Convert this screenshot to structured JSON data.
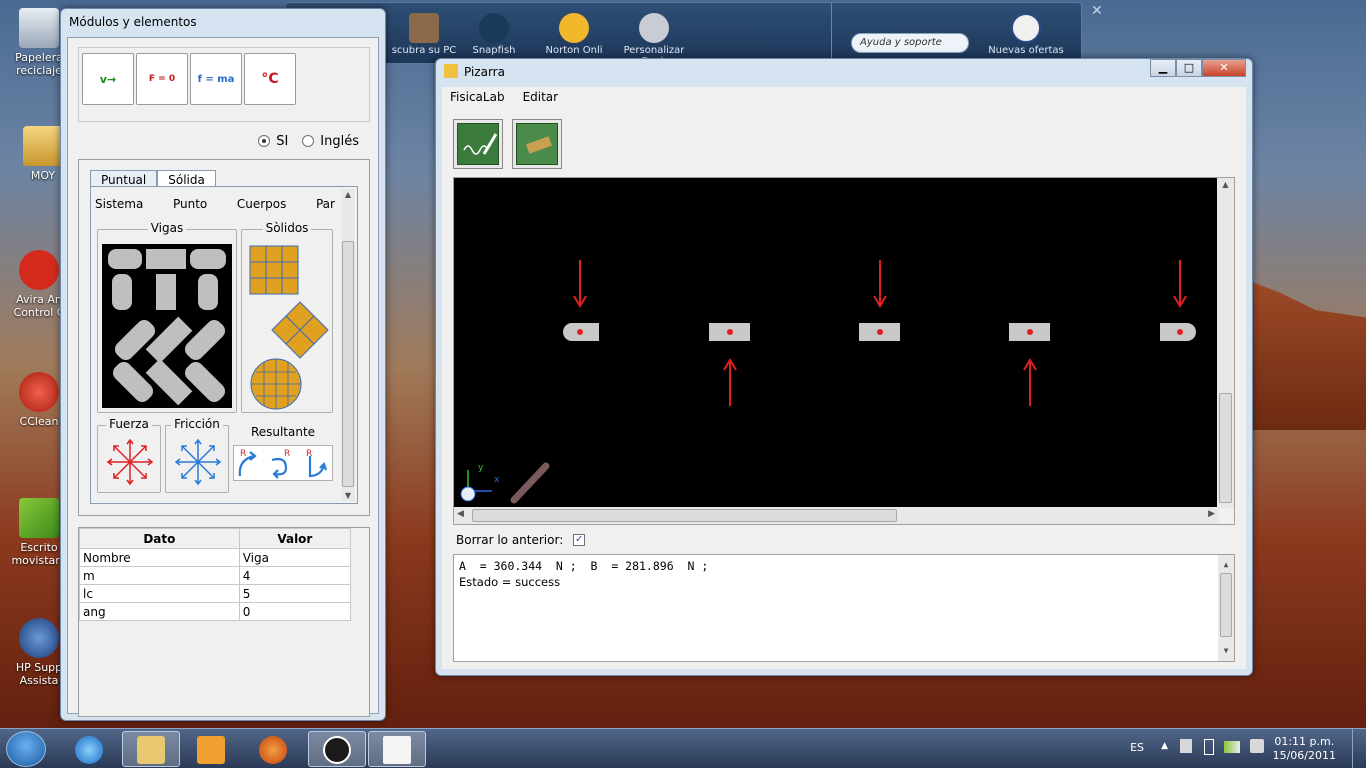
{
  "desktop": {
    "icons": [
      {
        "label": "Papelera\nreciclaje"
      },
      {
        "label": "MOY"
      },
      {
        "label": "Avira An\nControl C"
      },
      {
        "label": "CClean"
      },
      {
        "label": "Escrito\nmovistar I"
      },
      {
        "label": "HP Supp\nAssista"
      }
    ]
  },
  "gadgets": {
    "items": [
      {
        "label": "scubra su PC"
      },
      {
        "label": "Snapfish"
      },
      {
        "label": "Norton Onli"
      },
      {
        "label": "Personalizar Dock"
      },
      {
        "label": "Nuevas ofertas"
      }
    ],
    "help_placeholder": "Ayuda y soporte"
  },
  "modules_window": {
    "title": "Módulos y elementos",
    "module_buttons": [
      {
        "label": "v→",
        "icon": "velocity-icon"
      },
      {
        "label": "F = 0",
        "icon": "statics-icon"
      },
      {
        "label": "f = ma",
        "icon": "dynamics-icon"
      },
      {
        "label": "°C",
        "icon": "thermometer-icon"
      }
    ],
    "units": {
      "si": "SI",
      "ingles": "Inglés",
      "selected": "SI"
    },
    "tabs": [
      "Puntual",
      "Sólida"
    ],
    "active_tab": "Sólida",
    "categories": [
      "Sistema",
      "Punto",
      "Cuerpos",
      "Par"
    ],
    "groups": {
      "vigas": "Vigas",
      "solidos": "Sòlidos",
      "fuerza": "Fuerza",
      "friccion": "Fricción",
      "resultante": "Resultante"
    },
    "data_table": {
      "headers": [
        "Dato",
        "Valor"
      ],
      "rows": [
        [
          "Nombre",
          "Viga"
        ],
        [
          "m",
          "4"
        ],
        [
          "lc",
          "5"
        ],
        [
          "ang",
          "0"
        ]
      ]
    }
  },
  "pizarra": {
    "title": "Pizarra",
    "menu": [
      "FisicaLab",
      "Editar"
    ],
    "borrar_label": "Borrar lo anterior:",
    "borrar_checked": true,
    "output_lines": [
      "A  = 360.344  N ;  B  = 281.896  N ;",
      "Estado = success"
    ]
  },
  "taskbar": {
    "lang": "ES",
    "time": "01:11 p.m.",
    "date": "15/06/2011"
  }
}
